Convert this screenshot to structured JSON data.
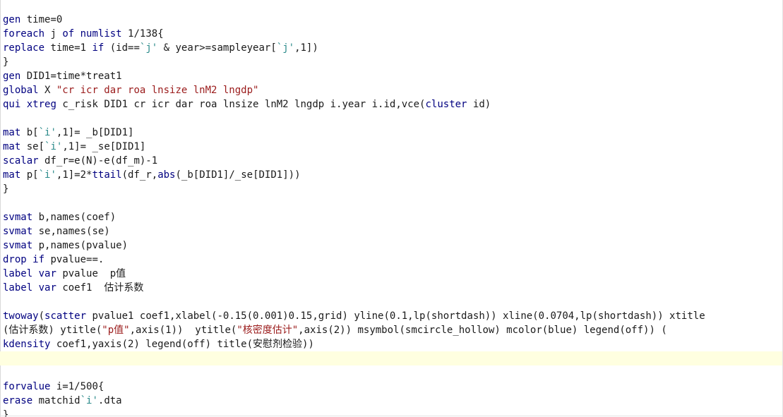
{
  "editor": {
    "lines": [
      [
        {
          "t": "gen",
          "c": "kw"
        },
        {
          "t": " time=0",
          "c": "plain"
        }
      ],
      [
        {
          "t": "foreach",
          "c": "kw"
        },
        {
          "t": " j ",
          "c": "plain"
        },
        {
          "t": "of",
          "c": "kw"
        },
        {
          "t": " ",
          "c": "plain"
        },
        {
          "t": "numlist",
          "c": "kw"
        },
        {
          "t": " 1/138{",
          "c": "plain"
        }
      ],
      [
        {
          "t": "replace",
          "c": "kw"
        },
        {
          "t": " time=1 ",
          "c": "plain"
        },
        {
          "t": "if",
          "c": "kw"
        },
        {
          "t": " (id==",
          "c": "plain"
        },
        {
          "t": "`j'",
          "c": "macro"
        },
        {
          "t": " & year>=sampleyear[",
          "c": "plain"
        },
        {
          "t": "`j'",
          "c": "macro"
        },
        {
          "t": ",1])",
          "c": "plain"
        }
      ],
      [
        {
          "t": "}",
          "c": "plain"
        }
      ],
      [
        {
          "t": "gen",
          "c": "kw"
        },
        {
          "t": " DID1=time*treat1",
          "c": "plain"
        }
      ],
      [
        {
          "t": "global",
          "c": "kw"
        },
        {
          "t": " X ",
          "c": "plain"
        },
        {
          "t": "\"cr icr dar roa lnsize lnM2 lngdp\"",
          "c": "str"
        }
      ],
      [
        {
          "t": "qui",
          "c": "kw"
        },
        {
          "t": " ",
          "c": "plain"
        },
        {
          "t": "xtreg",
          "c": "kw"
        },
        {
          "t": " c_risk DID1 cr icr dar roa lnsize lnM2 lngdp i.year i.id,vce(",
          "c": "plain"
        },
        {
          "t": "cluster",
          "c": "kw"
        },
        {
          "t": " id)",
          "c": "plain"
        }
      ],
      [],
      [
        {
          "t": "mat",
          "c": "kw"
        },
        {
          "t": " b[",
          "c": "plain"
        },
        {
          "t": "`i'",
          "c": "macro"
        },
        {
          "t": ",1]= _b[DID1]",
          "c": "plain"
        }
      ],
      [
        {
          "t": "mat",
          "c": "kw"
        },
        {
          "t": " se[",
          "c": "plain"
        },
        {
          "t": "`i'",
          "c": "macro"
        },
        {
          "t": ",1]= _se[DID1]",
          "c": "plain"
        }
      ],
      [
        {
          "t": "scalar",
          "c": "kw"
        },
        {
          "t": " df_r=e(N)-e(df_m)-1",
          "c": "plain"
        }
      ],
      [
        {
          "t": "mat",
          "c": "kw"
        },
        {
          "t": " p[",
          "c": "plain"
        },
        {
          "t": "`i'",
          "c": "macro"
        },
        {
          "t": ",1]=2*",
          "c": "plain"
        },
        {
          "t": "ttail",
          "c": "fn"
        },
        {
          "t": "(df_r,",
          "c": "plain"
        },
        {
          "t": "abs",
          "c": "fn"
        },
        {
          "t": "(_b[DID1]/_se[DID1]))",
          "c": "plain"
        }
      ],
      [
        {
          "t": "}",
          "c": "plain"
        }
      ],
      [],
      [
        {
          "t": "svmat",
          "c": "kw"
        },
        {
          "t": " b,names(coef)",
          "c": "plain"
        }
      ],
      [
        {
          "t": "svmat",
          "c": "kw"
        },
        {
          "t": " se,names(se)",
          "c": "plain"
        }
      ],
      [
        {
          "t": "svmat",
          "c": "kw"
        },
        {
          "t": " p,names(pvalue)",
          "c": "plain"
        }
      ],
      [
        {
          "t": "drop",
          "c": "kw"
        },
        {
          "t": " ",
          "c": "plain"
        },
        {
          "t": "if",
          "c": "kw"
        },
        {
          "t": " pvalue==.",
          "c": "plain"
        }
      ],
      [
        {
          "t": "label",
          "c": "kw"
        },
        {
          "t": " ",
          "c": "plain"
        },
        {
          "t": "var",
          "c": "kw"
        },
        {
          "t": " pvalue  p值",
          "c": "plain"
        }
      ],
      [
        {
          "t": "label",
          "c": "kw"
        },
        {
          "t": " ",
          "c": "plain"
        },
        {
          "t": "var",
          "c": "kw"
        },
        {
          "t": " coef1  估计系数",
          "c": "plain"
        }
      ],
      [],
      [
        {
          "t": "twoway",
          "c": "kw"
        },
        {
          "t": "(",
          "c": "plain"
        },
        {
          "t": "scatter",
          "c": "kw"
        },
        {
          "t": " pvalue1 coef1,xlabel(-0.15(0.001)0.15,grid) yline(0.1,lp(shortdash)) xline(0.0704,lp(shortdash)) xtitle",
          "c": "plain"
        }
      ],
      [
        {
          "t": "(估计系数) ytitle(",
          "c": "plain"
        },
        {
          "t": "\"p值\"",
          "c": "str"
        },
        {
          "t": ",axis(1))  ytitle(",
          "c": "plain"
        },
        {
          "t": "\"核密度估计\"",
          "c": "str"
        },
        {
          "t": ",axis(2)) msymbol(smcircle_hollow) mcolor(blue) legend(off)) (",
          "c": "plain"
        }
      ],
      [
        {
          "t": "kdensity",
          "c": "kw"
        },
        {
          "t": " coef1,yaxis(2) legend(off) title(安慰剂检验))",
          "c": "plain"
        }
      ],
      [],
      [],
      [
        {
          "t": "forvalue",
          "c": "kw"
        },
        {
          "t": " i=1/500{",
          "c": "plain"
        }
      ],
      [
        {
          "t": "erase",
          "c": "kw"
        },
        {
          "t": " matchid",
          "c": "plain"
        },
        {
          "t": "`i'",
          "c": "macro"
        },
        {
          "t": ".dta",
          "c": "plain"
        }
      ],
      [
        {
          "t": "}",
          "c": "plain"
        }
      ]
    ],
    "current_line_index": 24
  },
  "colors": {
    "keyword": "#000080",
    "string": "#9a1a1a",
    "macro": "#2a8a8a",
    "text": "#1a1a1a",
    "current_line_bg": "#ffffe0"
  }
}
